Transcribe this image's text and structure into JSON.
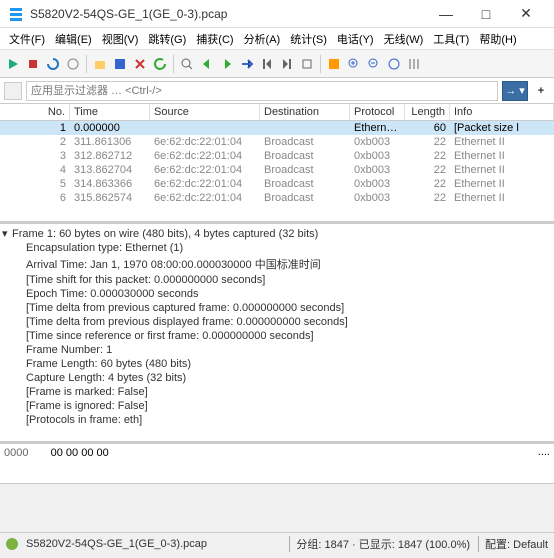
{
  "title": "S5820V2-54QS-GE_1(GE_0-3).pcap",
  "window_buttons": {
    "min": "—",
    "max": "□",
    "close": "✕"
  },
  "menus": [
    "文件(F)",
    "编辑(E)",
    "视图(V)",
    "跳转(G)",
    "捕获(C)",
    "分析(A)",
    "统计(S)",
    "电话(Y)",
    "无线(W)",
    "工具(T)",
    "帮助(H)"
  ],
  "filter": {
    "placeholder": "应用显示过滤器 … <Ctrl-/>"
  },
  "columns": [
    "No.",
    "Time",
    "Source",
    "Destination",
    "Protocol",
    "Length",
    "Info"
  ],
  "packets": [
    {
      "no": "1",
      "time": "0.000000",
      "src": "",
      "dst": "",
      "proto": "Ethern…",
      "len": "60",
      "info": "[Packet size l",
      "sel": true
    },
    {
      "no": "2",
      "time": "311.861306",
      "src": "6e:62:dc:22:01:04",
      "dst": "Broadcast",
      "proto": "0xb003",
      "len": "22",
      "info": "Ethernet II"
    },
    {
      "no": "3",
      "time": "312.862712",
      "src": "6e:62:dc:22:01:04",
      "dst": "Broadcast",
      "proto": "0xb003",
      "len": "22",
      "info": "Ethernet II"
    },
    {
      "no": "4",
      "time": "313.862704",
      "src": "6e:62:dc:22:01:04",
      "dst": "Broadcast",
      "proto": "0xb003",
      "len": "22",
      "info": "Ethernet II"
    },
    {
      "no": "5",
      "time": "314.863366",
      "src": "6e:62:dc:22:01:04",
      "dst": "Broadcast",
      "proto": "0xb003",
      "len": "22",
      "info": "Ethernet II"
    },
    {
      "no": "6",
      "time": "315.862574",
      "src": "6e:62:dc:22:01:04",
      "dst": "Broadcast",
      "proto": "0xb003",
      "len": "22",
      "info": "Ethernet II"
    }
  ],
  "frame": {
    "header": "Frame 1: 60 bytes on wire (480 bits), 4 bytes captured (32 bits)",
    "lines": [
      "Encapsulation type: Ethernet (1)",
      "Arrival Time: Jan  1, 1970 08:00:00.000030000 中国标准时间",
      "[Time shift for this packet: 0.000000000 seconds]",
      "Epoch Time: 0.000030000 seconds",
      "[Time delta from previous captured frame: 0.000000000 seconds]",
      "[Time delta from previous displayed frame: 0.000000000 seconds]",
      "[Time since reference or first frame: 0.000000000 seconds]",
      "Frame Number: 1",
      "Frame Length: 60 bytes (480 bits)",
      "Capture Length: 4 bytes (32 bits)",
      "[Frame is marked: False]",
      "[Frame is ignored: False]",
      "[Protocols in frame: eth]"
    ]
  },
  "hex": {
    "offset": "0000",
    "bytes": "00 00 00 00",
    "ascii": "...."
  },
  "status": {
    "file": "S5820V2-54QS-GE_1(GE_0-3).pcap",
    "pkts": "分组: 1847 · 已显示: 1847 (100.0%)",
    "profile": "配置: Default"
  }
}
